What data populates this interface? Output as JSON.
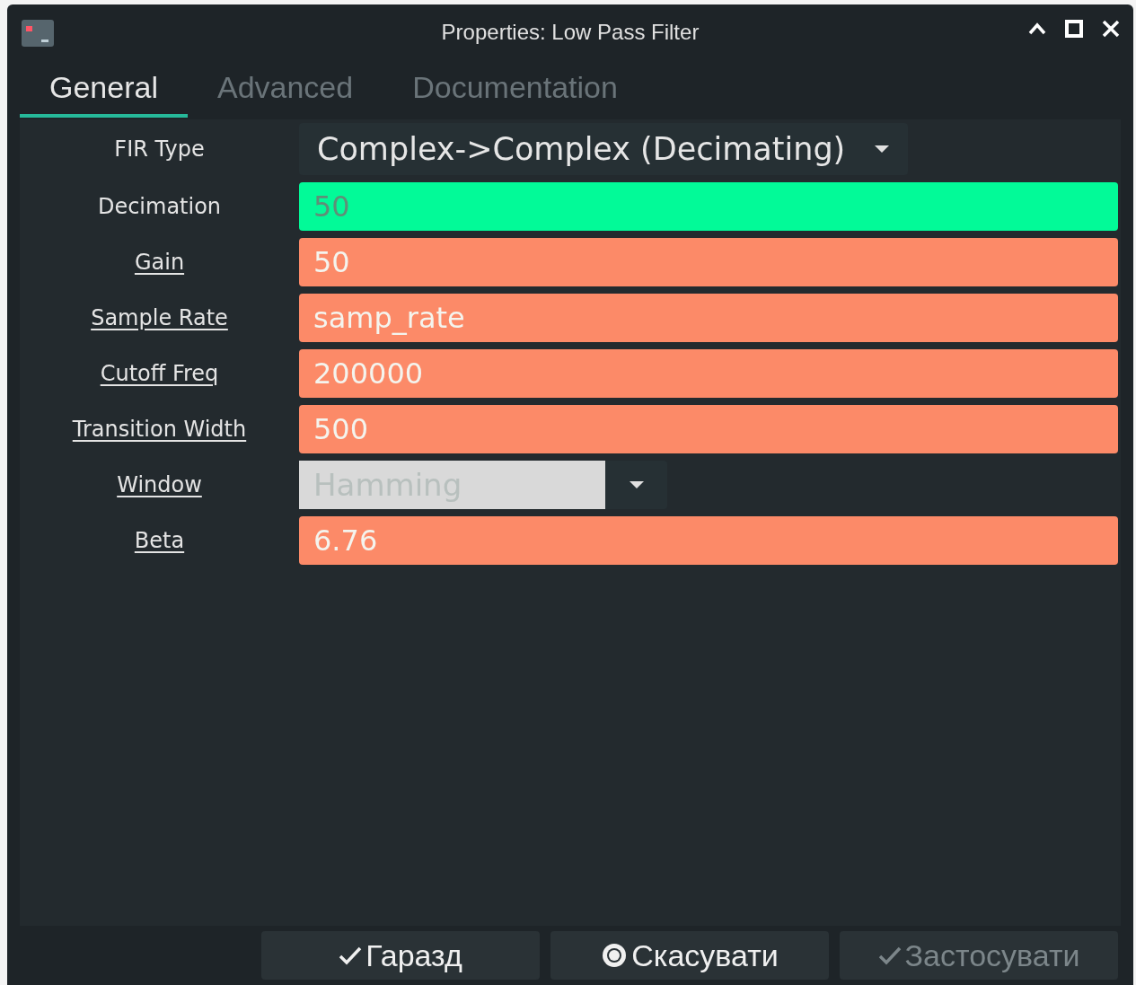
{
  "window": {
    "title": "Properties: Low Pass Filter"
  },
  "tabs": [
    {
      "label": "General",
      "selected": true
    },
    {
      "label": "Advanced",
      "selected": false
    },
    {
      "label": "Documentation",
      "selected": false
    }
  ],
  "params": [
    {
      "label": "FIR Type",
      "underlined": false,
      "kind": "dropdown",
      "value": "Complex->Complex (Decimating)"
    },
    {
      "label": "Decimation",
      "underlined": false,
      "kind": "entry",
      "value": "50",
      "color": "#02fa98"
    },
    {
      "label": "Gain",
      "underlined": true,
      "kind": "entry",
      "value": "50",
      "color": "#fc8a68"
    },
    {
      "label": "Sample Rate",
      "underlined": true,
      "kind": "entry",
      "value": "samp_rate",
      "color": "#fc8a68"
    },
    {
      "label": "Cutoff Freq",
      "underlined": true,
      "kind": "entry",
      "value": "200000",
      "color": "#fc8a68"
    },
    {
      "label": "Transition Width",
      "underlined": true,
      "kind": "entry",
      "value": "500",
      "color": "#fc8a68"
    },
    {
      "label": "Window",
      "underlined": true,
      "kind": "combo",
      "value": "Hamming"
    },
    {
      "label": "Beta",
      "underlined": true,
      "kind": "entry",
      "value": "6.76",
      "color": "#fc8a68"
    }
  ],
  "buttons": [
    {
      "label": "Гаразд",
      "kind": "check",
      "disabled": false
    },
    {
      "label": "Скасувати",
      "kind": "stop",
      "disabled": false
    },
    {
      "label": "Застосувати",
      "kind": "check",
      "disabled": true
    }
  ]
}
